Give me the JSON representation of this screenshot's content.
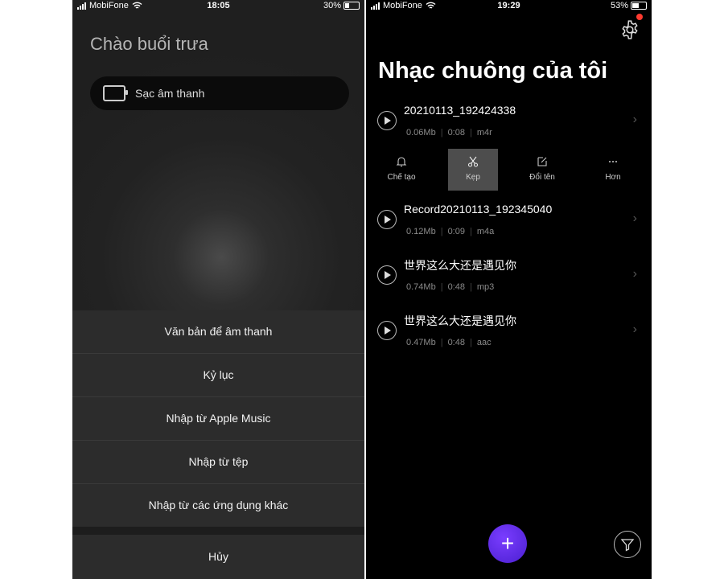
{
  "left": {
    "status": {
      "carrier": "MobiFone",
      "time": "18:05",
      "battery": "30%",
      "battery_level": 0.3
    },
    "greeting": "Chào buổi trưa",
    "charge_button": "Sạc âm thanh",
    "options": [
      "Văn bản để âm thanh",
      "Kỷ lục",
      "Nhập từ Apple Music",
      "Nhập từ tệp",
      "Nhập từ các ứng dụng khác"
    ],
    "cancel": "Hủy"
  },
  "right": {
    "status": {
      "carrier": "MobiFone",
      "time": "19:29",
      "battery": "53%",
      "battery_level": 0.53
    },
    "title": "Nhạc chuông của tôi",
    "songs": [
      {
        "name": "20210113_192424338",
        "size": "0.06Mb",
        "duration": "0:08",
        "format": "m4r"
      },
      {
        "name": "Record20210113_192345040",
        "size": "0.12Mb",
        "duration": "0:09",
        "format": "m4a"
      },
      {
        "name": "世界这么大还是遇见你",
        "size": "0.74Mb",
        "duration": "0:48",
        "format": "mp3"
      },
      {
        "name": "世界这么大还是遇见你",
        "size": "0.47Mb",
        "duration": "0:48",
        "format": "aac"
      }
    ],
    "actions": [
      {
        "label": "Chế tạo",
        "icon": "bell-icon"
      },
      {
        "label": "Kẹp",
        "icon": "scissors-icon",
        "active": true
      },
      {
        "label": "Đổi tên",
        "icon": "edit-icon"
      },
      {
        "label": "Hơn",
        "icon": "more-icon"
      }
    ],
    "fab_icon": "plus",
    "accent": "#5b2ef0"
  }
}
